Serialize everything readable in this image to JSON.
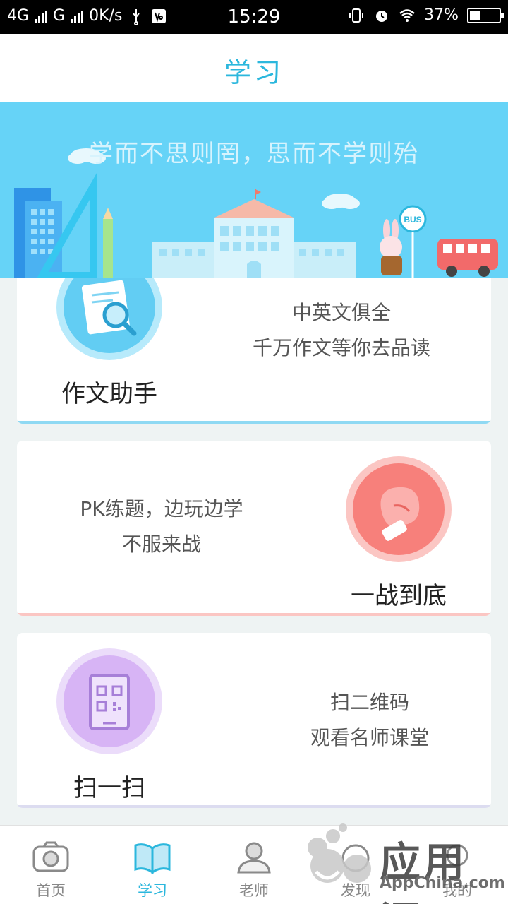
{
  "status_bar": {
    "network_4g": "4G",
    "network_g": "G",
    "speed": "0K/s",
    "time": "15:29",
    "battery": "37%",
    "battery_level": 0.37
  },
  "header": {
    "title": "学习"
  },
  "banner": {
    "motto": "学而不思则罔，思而不学则殆",
    "bus_sign": "BUS"
  },
  "cards": [
    {
      "title": "作文助手",
      "desc_line1": "中英文俱全",
      "desc_line2": "千万作文等你去品读",
      "icon": "magnifier-document-icon",
      "color": "#62cdf3"
    },
    {
      "title": "一战到底",
      "desc_line1": "PK练题，边玩边学",
      "desc_line2": "不服来战",
      "icon": "boxing-glove-icon",
      "color": "#f7807b"
    },
    {
      "title": "扫一扫",
      "desc_line1": "扫二维码",
      "desc_line2": "观看名师课堂",
      "icon": "qr-tablet-icon",
      "color": "#d7b4f5"
    }
  ],
  "tabs": [
    {
      "label": "首页",
      "icon": "camera-icon",
      "active": false
    },
    {
      "label": "学习",
      "icon": "book-icon",
      "active": true
    },
    {
      "label": "老师",
      "icon": "person-icon",
      "active": false
    },
    {
      "label": "发现",
      "icon": "discover-icon",
      "active": false
    },
    {
      "label": "我的",
      "icon": "profile-icon",
      "active": false
    }
  ],
  "watermark": {
    "text": "应用汇",
    "sub": "AppChina.com"
  }
}
